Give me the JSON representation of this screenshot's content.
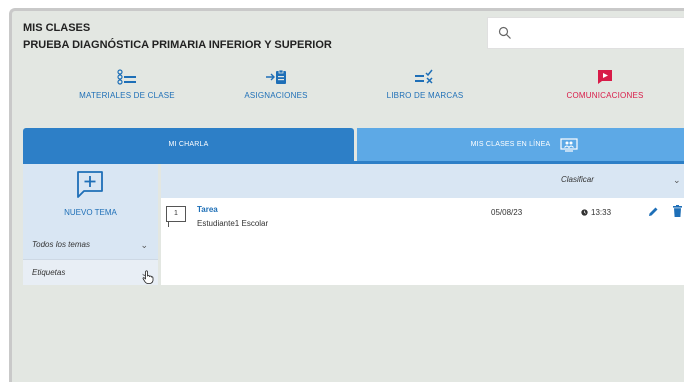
{
  "header": {
    "title": "MIS CLASES",
    "subtitle": "PRUEBA DIAGNÓSTICA PRIMARIA INFERIOR Y SUPERIOR"
  },
  "search": {
    "placeholder": "",
    "value": ""
  },
  "nav": [
    {
      "label": "MATERIALES DE CLASE",
      "icon": "list-bullets-icon"
    },
    {
      "label": "ASIGNACIONES",
      "icon": "clipboard-arrow-icon"
    },
    {
      "label": "LIBRO DE MARCAS",
      "icon": "gradebook-icon"
    },
    {
      "label": "COMUNICACIONES",
      "icon": "message-play-icon"
    }
  ],
  "tabs": {
    "active": "MI CHARLA",
    "inactive": "MIS CLASES EN LÍNEA"
  },
  "sidebar": {
    "new_topic": "NUEVO TEMA",
    "filter_all": "Todos los temas",
    "filter_tags": "Etiquetas"
  },
  "sort": {
    "label": "Clasificar"
  },
  "posts": [
    {
      "replies": "1",
      "title": "Tarea",
      "author": "Estudiante1 Escolar",
      "date": "05/08/23",
      "time": "13:33"
    }
  ],
  "colors": {
    "accent_blue": "#2d7fc7",
    "light_blue": "#5da9e6",
    "link_blue": "#1e6fb7",
    "communications_red": "#d81b48",
    "background": "#e3e7e2"
  }
}
